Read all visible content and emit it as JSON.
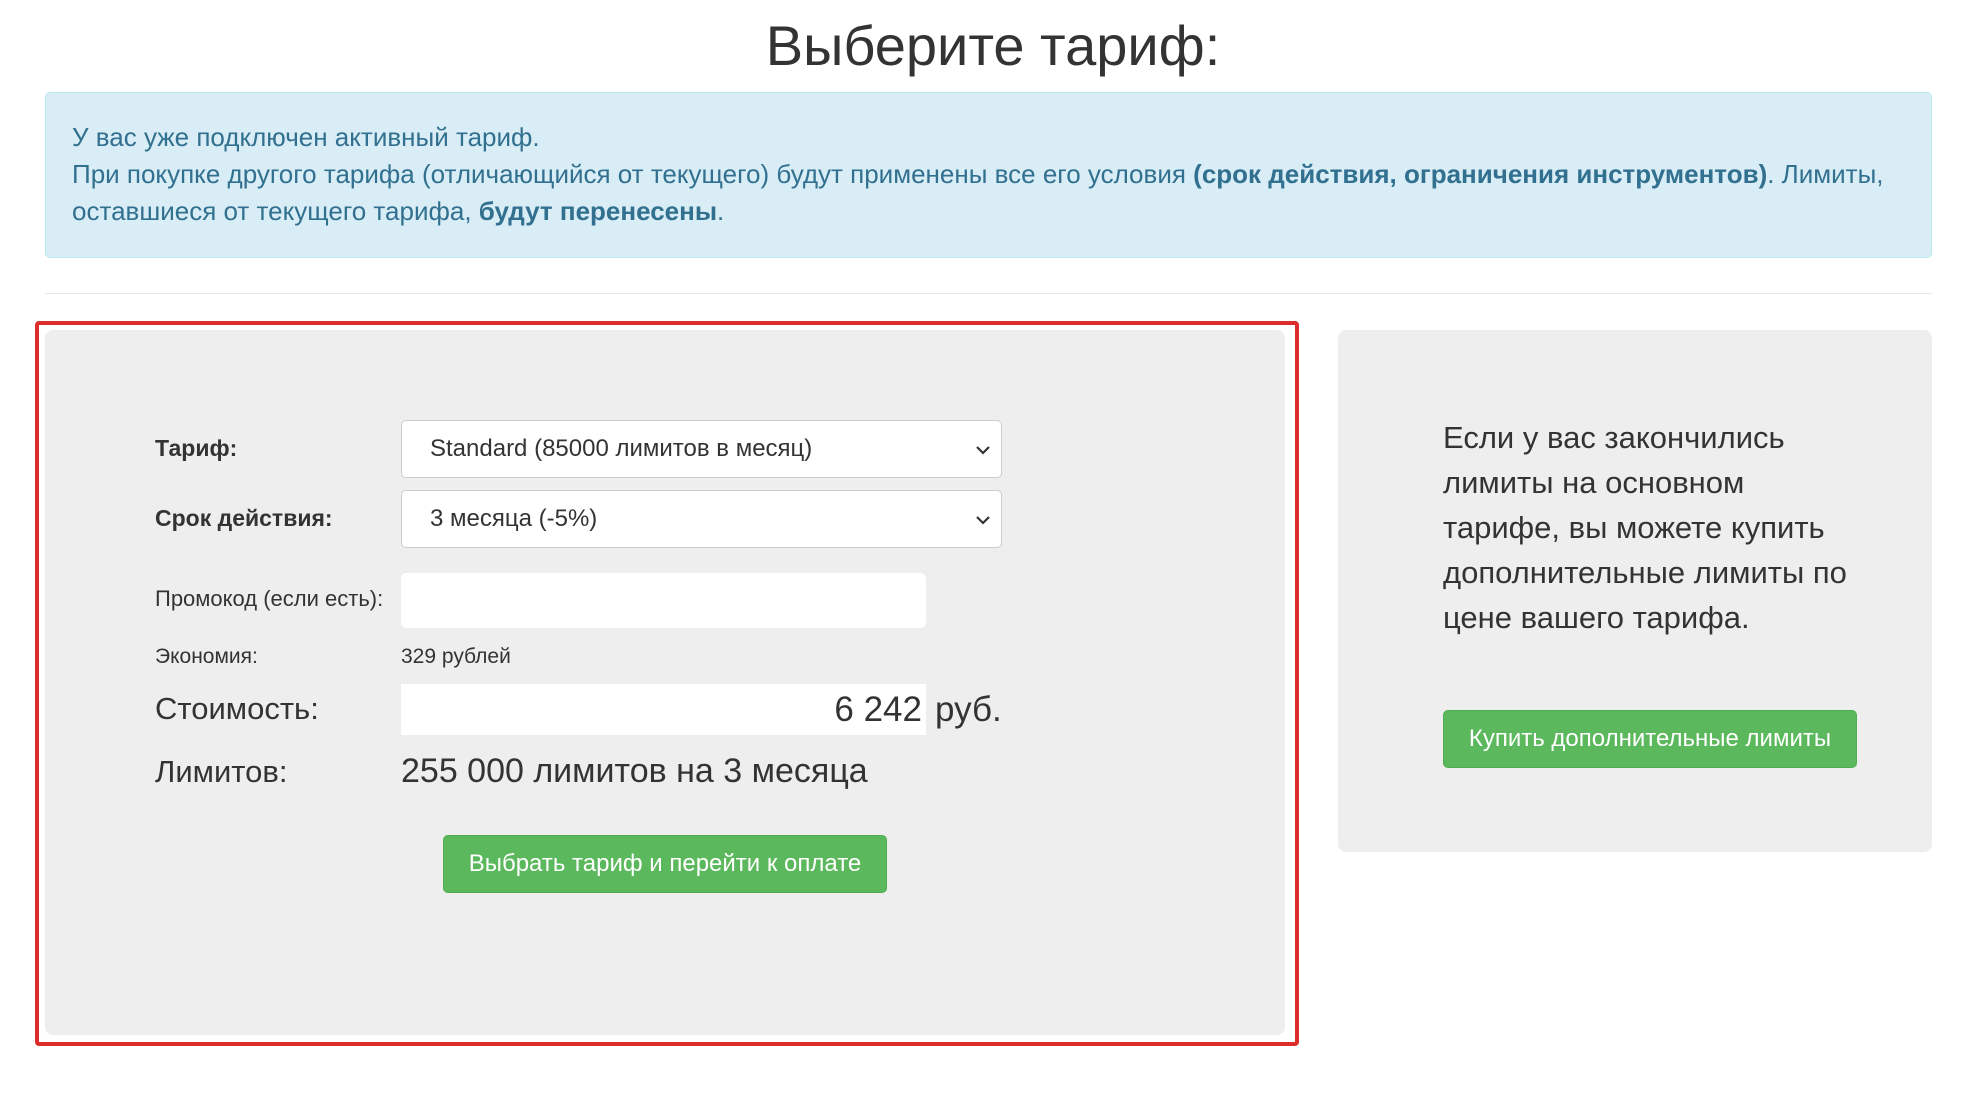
{
  "page_title": "Выберите тариф:",
  "notice": {
    "line1": "У вас уже подключен активный тариф.",
    "line2_start": "При покупке другого тарифа (отличающийся от текущего) будут применены все его условия ",
    "line2_bold": "(срок действия, ограничения инструментов)",
    "line2_mid": ". Лимиты, оставшиеся от текущего тарифа, ",
    "line2_bold2": "будут перенесены",
    "line2_end": "."
  },
  "form": {
    "tariff_label": "Тариф:",
    "tariff_value": "Standard (85000 лимитов в месяц)",
    "term_label": "Срок действия:",
    "term_value": "3 месяца (-5%)",
    "promo_label": "Промокод (если есть):",
    "promo_value": "",
    "savings_label": "Экономия:",
    "savings_value": "329 рублей",
    "cost_label": "Стоимость:",
    "cost_value": "6 242",
    "cost_currency": "руб.",
    "limits_label": "Лимитов:",
    "limits_value": "255 000 лимитов на 3 месяца",
    "submit_label": "Выбрать тариф и перейти к оплате"
  },
  "side": {
    "text": "Если у вас закончились лимиты на основном тарифе, вы можете купить дополнительные лимиты по цене вашего тарифа.",
    "button_label": "Купить дополнительные лимиты"
  },
  "colors": {
    "alert_bg": "#d9edf7",
    "alert_text": "#31708f",
    "button_green": "#5cb85c",
    "highlight_red": "#dd2c2c",
    "panel_bg": "#eeeeee"
  },
  "icons": {
    "select_arrow": "chevron-down-icon"
  }
}
